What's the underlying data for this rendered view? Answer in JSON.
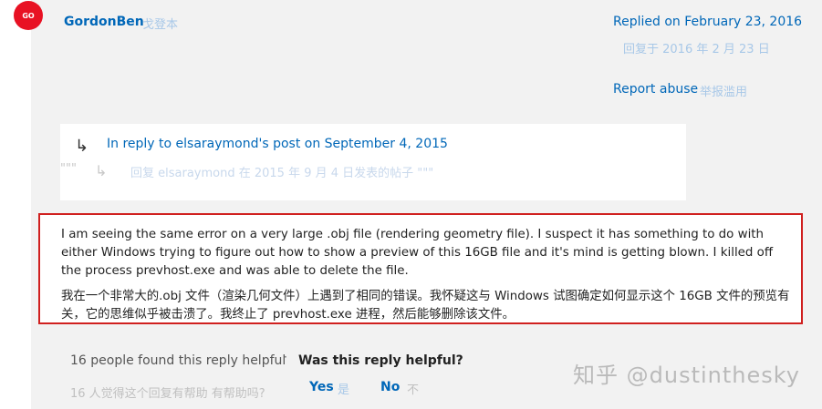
{
  "author": {
    "initials": "GO",
    "name": "GordonBen",
    "name_cn": "戈登本",
    "avatar_color": "#e81123"
  },
  "meta": {
    "replied": "Replied on February 23, 2016",
    "replied_cn": "回复于 2016 年 2 月 23 日",
    "report": "Report abuse",
    "report_cn": "举报滥用"
  },
  "in_reply": {
    "arrow_icon": "reply-arrow",
    "text": "In reply to elsaraymond's post on September 4, 2015",
    "quote_marks": "\"\"\"",
    "text_cn": "回复 elsaraymond 在 2015 年 9 月 4 日发表的帖子 \"\"\""
  },
  "post": {
    "body_en": "I am seeing the same error on a very large .obj file (rendering geometry file).  I suspect it has something to do with either Windows trying to figure out how to show a preview of this 16GB file and it's mind is getting blown.  I killed off the process prevhost.exe and was able to delete the file.",
    "body_cn": "我在一个非常大的.obj 文件（渲染几何文件）上遇到了相同的错误。我怀疑这与 Windows 试图确定如何显示这个 16GB 文件的预览有关，它的思维似乎被击溃了。我终止了 prevhost.exe 进程，然后能够删除该文件。",
    "highlight_color": "#d0201f"
  },
  "feedback": {
    "count_text": "16 people found this reply helpful",
    "separator": "·",
    "question": "Was this reply helpful?",
    "count_text_cn": "16 人觉得这个回复有帮助 有帮助吗?",
    "yes": "Yes",
    "yes_cn": "是",
    "no": "No",
    "no_cn": "不"
  },
  "watermark": "知乎 @dustinthesky",
  "colors": {
    "link": "#0067b8",
    "panel": "#f2f2f2"
  }
}
